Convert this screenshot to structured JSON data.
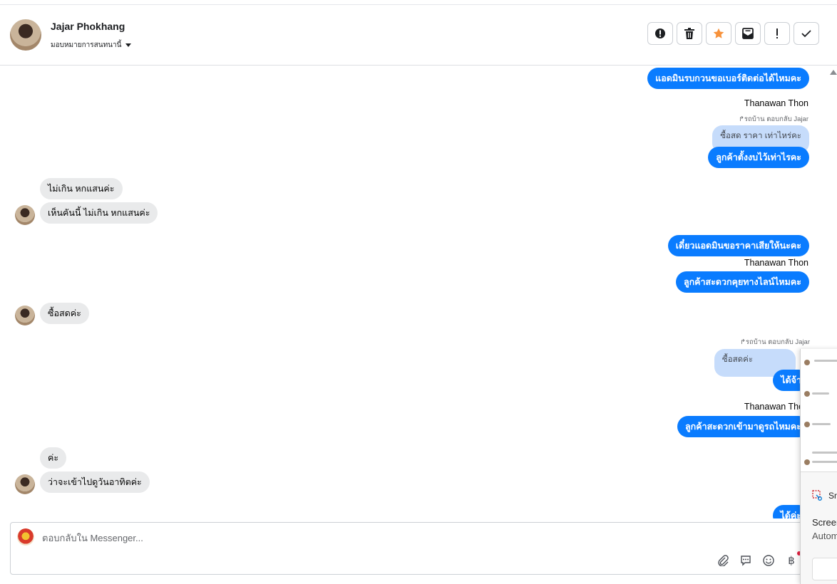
{
  "header": {
    "name": "Jajar Phokhang",
    "assign_label": "มอบหมายการสนทนานี้"
  },
  "actions": [
    {
      "icon": "alert-circle-icon"
    },
    {
      "icon": "trash-icon"
    },
    {
      "icon": "star-icon",
      "color": "#f7923b"
    },
    {
      "icon": "mark-unread-icon"
    },
    {
      "icon": "exclamation-icon"
    },
    {
      "icon": "check-icon"
    }
  ],
  "messages": {
    "m1": "แอดมินรบกวนขอเบอร์ติดต่อได้ไหมคะ",
    "sender1": "Thanawan Thon",
    "reply_note1": "รถบ้าน ตอบกลับ Jajar",
    "quote1": "ซื้อสด ราคา เท่าไหร่คะ",
    "m2": "ลูกค้าตั้งงบไว้เท่าไรคะ",
    "in1": "ไม่เกิน หกแสนค่ะ",
    "in2": "เห็นคันนี้ ไม่เกิน หกแสนค่ะ",
    "m3": "เดี๋ยวแอดมินขอราคาเสียให้นะคะ",
    "sender2": "Thanawan Thon",
    "m4": "ลูกค้าสะดวกคุยทางไลน์ไหมคะ",
    "in3": "ซื้อสดค่ะ",
    "reply_note2": "รถบ้าน ตอบกลับ Jajar",
    "quote2": "ซื้อสดค่ะ",
    "m5": "ได้จ้า",
    "sender3": "Thanawan Thon",
    "m6": "ลูกค้าสะดวกเข้ามาดูรถไหมคะ",
    "in4": "ค่ะ",
    "in5": "ว่าจะเข้าไปดูวันอาทิตค่ะ",
    "m7": "ได้ค่ะ"
  },
  "composer": {
    "placeholder": "ตอบกลับใน Messenger..."
  },
  "composer_tools": [
    {
      "icon": "paperclip-icon"
    },
    {
      "icon": "saved-reply-icon"
    },
    {
      "icon": "emoji-icon"
    },
    {
      "icon": "baht-icon",
      "glyph": "฿"
    }
  ],
  "snip_overlay": {
    "app": "Sn",
    "line1": "Screen",
    "line2": "Autom"
  }
}
